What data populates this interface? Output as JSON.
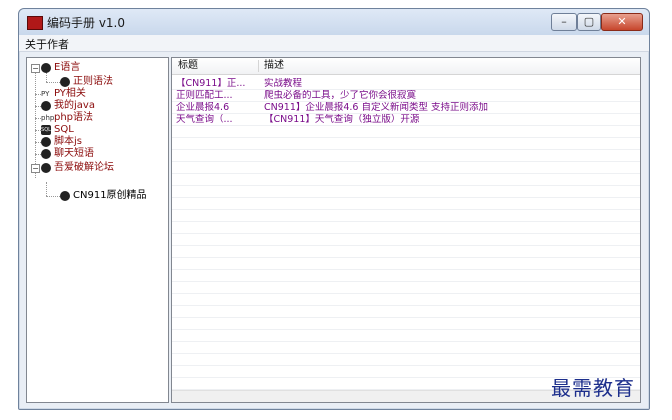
{
  "window": {
    "title": "编码手册 v1.0"
  },
  "controls": {
    "minimize": "–",
    "maximize": "▢",
    "close": "✕"
  },
  "menu": {
    "items": [
      "关于作者"
    ]
  },
  "tree": {
    "nodes": [
      {
        "label": "E语言",
        "icon": "help-icon"
      },
      {
        "label": "正则语法",
        "icon": "help-icon"
      },
      {
        "label": "PY相关",
        "icon": "python-icon",
        "badge": "PY"
      },
      {
        "label": "我的java",
        "icon": "java-icon"
      },
      {
        "label": "php语法",
        "icon": "php-icon",
        "badge": "php"
      },
      {
        "label": "SQL",
        "icon": "sql-icon",
        "badge": "SQL"
      },
      {
        "label": "脚本js",
        "icon": "js-icon"
      },
      {
        "label": "聊天短语",
        "icon": "chat-icon"
      },
      {
        "label": "吾爱破解论坛",
        "icon": "forum-icon"
      },
      {
        "label": "CN911原创精品",
        "icon": "forum-icon"
      }
    ]
  },
  "list": {
    "columns": [
      "标题",
      "描述"
    ],
    "rows": [
      {
        "title": "【CN911】正...",
        "desc": "实战教程"
      },
      {
        "title": "正则匹配工...",
        "desc": "爬虫必备的工具，少了它你会很寂寞"
      },
      {
        "title": "企业晨报4.6",
        "desc": "CN911】企业晨报4.6 自定义新闻类型 支持正则添加"
      },
      {
        "title": "天气查询（...",
        "desc": "【CN911】天气查询（独立版）开源"
      }
    ]
  },
  "watermark": "最需教育",
  "colors": {
    "accent": "#7a0c8a",
    "tree_text": "#8b0b0b",
    "watermark": "#1d2f8c"
  }
}
